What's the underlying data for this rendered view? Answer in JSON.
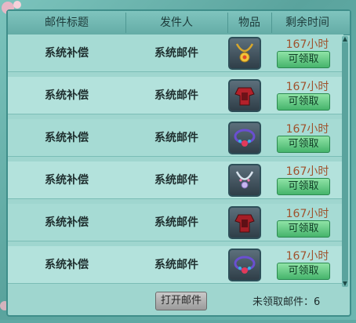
{
  "header": {
    "col_title": "邮件标题",
    "col_sender": "发件人",
    "col_item": "物品",
    "col_time": "剩余时间"
  },
  "mails": [
    {
      "title": "系统补偿",
      "sender": "系统邮件",
      "item_icon": "necklace-gold-icon",
      "time": "167小时",
      "claim": "可领取"
    },
    {
      "title": "系统补偿",
      "sender": "系统邮件",
      "item_icon": "red-armor-icon",
      "time": "167小时",
      "claim": "可领取"
    },
    {
      "title": "系统补偿",
      "sender": "系统邮件",
      "item_icon": "blue-purple-necklace-icon",
      "time": "167小时",
      "claim": "可领取"
    },
    {
      "title": "系统补偿",
      "sender": "系统邮件",
      "item_icon": "silver-necklace-icon",
      "time": "167小时",
      "claim": "可领取"
    },
    {
      "title": "系统补偿",
      "sender": "系统邮件",
      "item_icon": "red-armor-icon",
      "time": "167小时",
      "claim": "可领取"
    },
    {
      "title": "系统补偿",
      "sender": "系统邮件",
      "item_icon": "blue-purple-necklace-icon",
      "time": "167小时",
      "claim": "可领取"
    }
  ],
  "footer": {
    "open_button": "打开邮件",
    "unread_label": "未领取邮件：",
    "unread_count": "6"
  },
  "colors": {
    "time": "#a0522d",
    "claim": "#46b46c"
  }
}
